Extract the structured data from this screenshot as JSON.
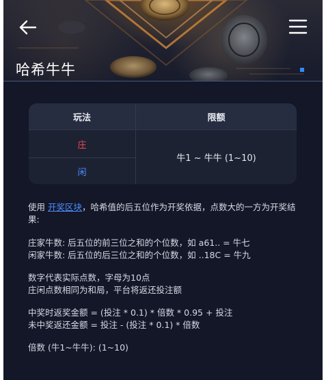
{
  "header": {
    "title": "哈希牛牛"
  },
  "table": {
    "col_play": "玩法",
    "col_limit": "限额",
    "row_banker": "庄",
    "row_player": "闲",
    "limit_value": "牛1 ~ 牛牛 (1~10)"
  },
  "rules": {
    "intro_prefix": "使用 ",
    "intro_link": "开奖区块",
    "intro_rest": "，哈希值的后五位作为开奖依据，点数大的一方为开奖结果:",
    "banker_rule": "庄家牛数: 后五位的前三位之和的个位数，如 a61.. = 牛七",
    "player_rule": "闲家牛数: 后五位的后三位之和的个位数，如 ..18C = 牛九",
    "digit_rule": "数字代表实际点数，字母为10点",
    "tie_rule": "庄闲点数相同为和局，平台将返还投注额",
    "win_formula": "中奖时返奖金额 = (投注 * 0.1) * 倍数 * 0.95 + 投注",
    "lose_formula": "未中奖返还金额 = 投注 - (投注 * 0.1) * 倍数",
    "multiplier": "倍数 (牛1~牛牛): (1~10)"
  },
  "colors": {
    "background": "#131728",
    "banker": "#f0484e",
    "player": "#4d8dff",
    "link": "#4e8dff",
    "badge": "#2e8bff"
  },
  "icons": {
    "back": "arrow-left-icon",
    "menu": "hamburger-menu-icon"
  }
}
